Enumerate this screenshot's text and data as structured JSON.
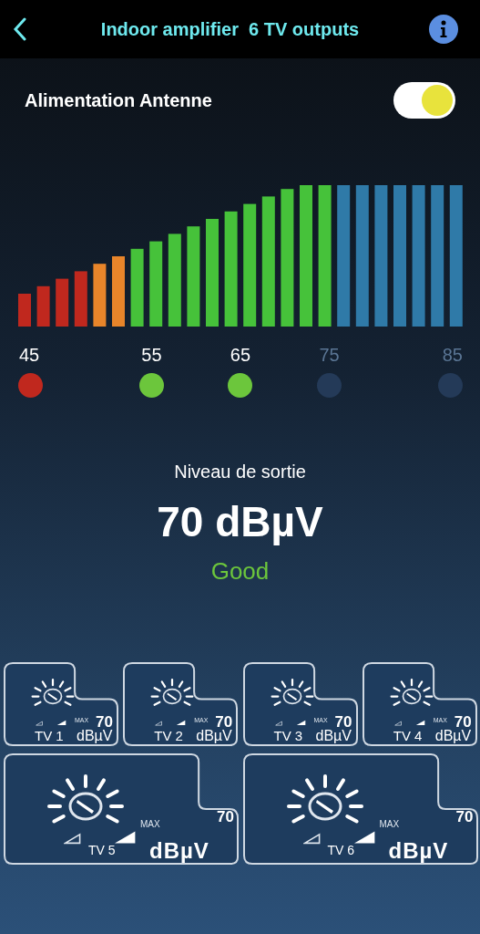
{
  "header": {
    "title": "Indoor amplifier  6 TV outputs"
  },
  "antenna_power": {
    "label": "Alimentation Antenne",
    "on": true
  },
  "scale": [
    {
      "label": "45",
      "active": true,
      "color": "#c0281e"
    },
    {
      "label": "55",
      "active": true,
      "color": "#6cc63c"
    },
    {
      "label": "65",
      "active": true,
      "color": "#6cc63c"
    },
    {
      "label": "75",
      "active": false,
      "color": "#243a58"
    },
    {
      "label": "85",
      "active": false,
      "color": "#243a58"
    }
  ],
  "output": {
    "caption": "Niveau de sortie",
    "value": "70 dBµV",
    "status": "Good"
  },
  "outputs": [
    {
      "kind": "small",
      "label": "TV 1",
      "max": "MAX",
      "value": "70",
      "unit": "dBµV"
    },
    {
      "kind": "small",
      "label": "TV 2",
      "max": "MAX",
      "value": "70",
      "unit": "dBµV"
    },
    {
      "kind": "small",
      "label": "TV 3",
      "max": "MAX",
      "value": "70",
      "unit": "dBµV"
    },
    {
      "kind": "small",
      "label": "TV 4",
      "max": "MAX",
      "value": "70",
      "unit": "dBµV"
    },
    {
      "kind": "large",
      "label": "TV 5",
      "max": "MAX",
      "value": "70",
      "unit": "dBµV"
    },
    {
      "kind": "large",
      "label": "TV 6",
      "max": "MAX",
      "value": "70",
      "unit": "dBµV"
    }
  ]
}
